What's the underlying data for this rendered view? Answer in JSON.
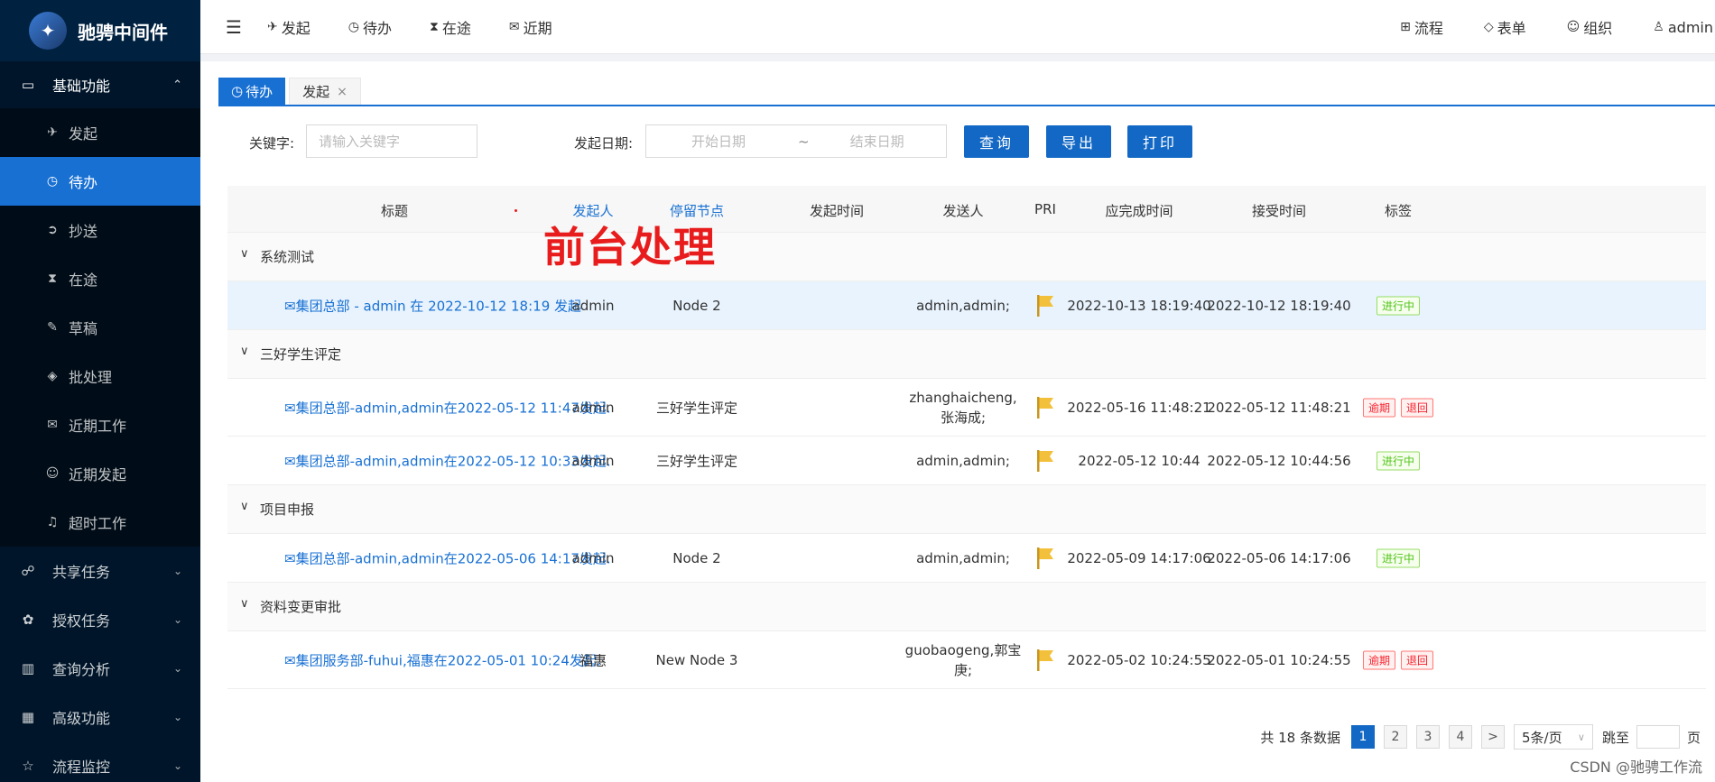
{
  "app": {
    "title": "驰骋中间件",
    "logo_glyph": "✦"
  },
  "sidebar": {
    "group_basic": {
      "label": "基础功能",
      "icon": "folder-icon"
    },
    "items": [
      {
        "label": "发起",
        "icon": "✈"
      },
      {
        "label": "待办",
        "icon": "◷",
        "active": true
      },
      {
        "label": "抄送",
        "icon": "➲"
      },
      {
        "label": "在途",
        "icon": "⧗"
      },
      {
        "label": "草稿",
        "icon": "✎"
      },
      {
        "label": "批处理",
        "icon": "◈"
      },
      {
        "label": "近期工作",
        "icon": "✉"
      },
      {
        "label": "近期发起",
        "icon": "☺"
      },
      {
        "label": "超时工作",
        "icon": "♫"
      }
    ],
    "groups": [
      {
        "label": "共享任务",
        "icon": "☍"
      },
      {
        "label": "授权任务",
        "icon": "✿"
      },
      {
        "label": "查询分析",
        "icon": "▥"
      },
      {
        "label": "高级功能",
        "icon": "▦"
      },
      {
        "label": "流程监控",
        "icon": "☆"
      }
    ]
  },
  "header": {
    "nav": [
      {
        "label": "发起",
        "icon": "✈"
      },
      {
        "label": "待办",
        "icon": "◷"
      },
      {
        "label": "在途",
        "icon": "⧗"
      },
      {
        "label": "近期",
        "icon": "✉"
      }
    ],
    "right": [
      {
        "label": "流程",
        "icon": "⊞"
      },
      {
        "label": "表单",
        "icon": "◇"
      },
      {
        "label": "组织",
        "icon": "☺"
      },
      {
        "label": "admin",
        "icon": "♙"
      }
    ]
  },
  "tabs": [
    {
      "label": "待办",
      "icon": "◷",
      "active": true
    },
    {
      "label": "发起",
      "close": "×"
    }
  ],
  "filter": {
    "keyword_label": "关键字:",
    "keyword_placeholder": "请输入关键字",
    "date_label": "发起日期:",
    "start_placeholder": "开始日期",
    "tilde": "~",
    "end_placeholder": "结束日期",
    "query": "查询",
    "export": "导出",
    "print": "打印"
  },
  "overlay_title": "前台处理",
  "table": {
    "headers": [
      "标题",
      "发起人",
      "停留节点",
      "发起时间",
      "发送人",
      "PRI",
      "应完成时间",
      "接受时间",
      "标签"
    ],
    "groups": [
      {
        "name": "系统测试",
        "rows": [
          {
            "title": "集团总部 - admin 在 2022-10-12 18:19 发起",
            "icon": "✉",
            "starter": "admin",
            "node": "Node 2",
            "sent": "",
            "sender": "admin,admin;",
            "due": "2022-10-13 18:19:40",
            "received": "2022-10-12 18:19:40",
            "tags": [
              {
                "text": "进行中",
                "color": "green"
              }
            ],
            "highlight": true
          }
        ]
      },
      {
        "name": "三好学生评定",
        "rows": [
          {
            "title": "集团总部-admin,admin在2022-05-12 11:47发起.",
            "icon": "✉",
            "starter": "admin",
            "node": "三好学生评定",
            "sent": "",
            "sender": "zhanghaicheng,张海成;",
            "due": "2022-05-16 11:48:21",
            "received": "2022-05-12 11:48:21",
            "tags": [
              {
                "text": "逾期",
                "color": "red"
              },
              {
                "text": "退回",
                "color": "red"
              }
            ]
          },
          {
            "title": "集团总部-admin,admin在2022-05-12 10:33发起.",
            "icon": "✉",
            "starter": "admin",
            "node": "三好学生评定",
            "sent": "",
            "sender": "admin,admin;",
            "due": "2022-05-12 10:44",
            "received": "2022-05-12 10:44:56",
            "tags": [
              {
                "text": "进行中",
                "color": "green"
              }
            ]
          }
        ]
      },
      {
        "name": "项目申报",
        "rows": [
          {
            "title": "集团总部-admin,admin在2022-05-06 14:17发起.",
            "icon": "✉",
            "starter": "admin",
            "node": "Node 2",
            "sent": "",
            "sender": "admin,admin;",
            "due": "2022-05-09 14:17:06",
            "received": "2022-05-06 14:17:06",
            "tags": [
              {
                "text": "进行中",
                "color": "green"
              }
            ]
          }
        ]
      },
      {
        "name": "资料变更审批",
        "rows": [
          {
            "title": "集团服务部-fuhui,福惠在2022-05-01 10:24发起.",
            "icon": "✉",
            "starter": "福惠",
            "node": "New Node 3",
            "sent": "",
            "sender": "guobaogeng,郭宝庚;",
            "due": "2022-05-02 10:24:55",
            "received": "2022-05-01 10:24:55",
            "tags": [
              {
                "text": "逾期",
                "color": "red"
              },
              {
                "text": "退回",
                "color": "red"
              }
            ]
          }
        ]
      }
    ]
  },
  "pager": {
    "total": "共 18 条数据",
    "pages": [
      "1",
      "2",
      "3",
      "4"
    ],
    "active_page": "1",
    "next": ">",
    "page_size": "5条/页",
    "jump_label": "跳至",
    "page_suffix": "页"
  },
  "credit": "CSDN @驰骋工作流",
  "colors": {
    "sidebar": "#001529",
    "accent": "#1870d3",
    "overlay": "#e81c1c"
  }
}
